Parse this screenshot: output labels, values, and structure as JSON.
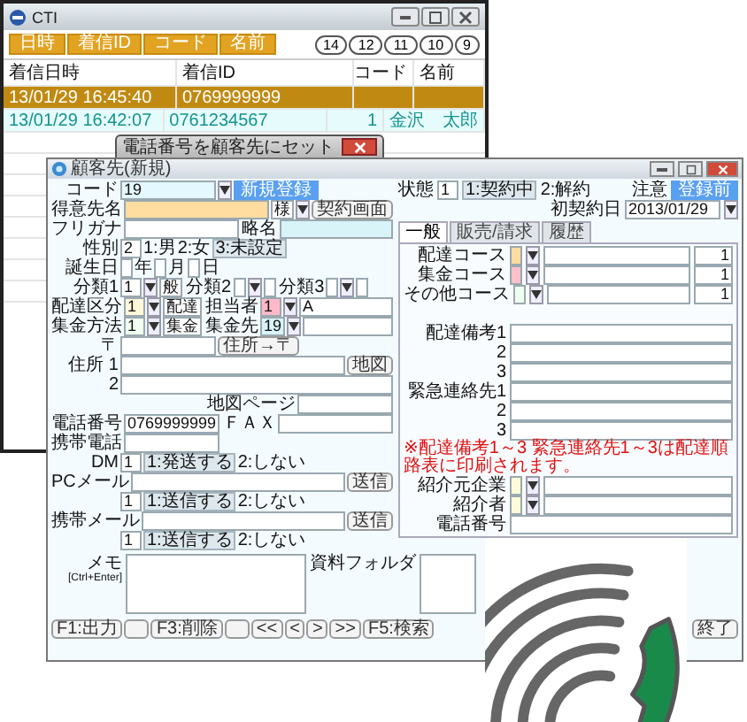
{
  "cti_window": {
    "title": "CTI",
    "tabs": [
      "日時",
      "着信ID",
      "コード",
      "名前"
    ],
    "page_tabs": [
      "14",
      "12",
      "11",
      "10",
      "9"
    ],
    "columns": [
      "着信日時",
      "着信ID",
      "コード",
      "名前"
    ],
    "rows": [
      {
        "cells": [
          "13/01/29 16:45:40",
          "0769999999",
          "",
          ""
        ],
        "selected": true
      },
      {
        "cells": [
          "13/01/29 16:42:07",
          "0761234567",
          "1",
          "金沢　太郎"
        ],
        "selected": false
      }
    ]
  },
  "dialog": {
    "title": "電話番号を顧客先にセット"
  },
  "customer_window": {
    "title": "顧客先(新規)",
    "left_rows": [
      {
        "items": [
          {
            "kind": "label",
            "text": "コード"
          },
          {
            "kind": "mid",
            "value": "19",
            "color": "#e4f8ff"
          },
          {
            "kind": "drop"
          },
          {
            "kind": "action",
            "text": "新規登録"
          }
        ]
      },
      {
        "items": [
          {
            "kind": "label",
            "text": "得意先名"
          },
          {
            "kind": "wide",
            "color": "#ffdca0"
          },
          {
            "kind": "field",
            "value": "様"
          },
          {
            "kind": "drop"
          },
          {
            "kind": "btn",
            "text": "契約画面"
          }
        ]
      },
      {
        "items": [
          {
            "kind": "label",
            "text": "フリガナ"
          },
          {
            "kind": "wide"
          },
          {
            "kind": "label",
            "text": "略名"
          },
          {
            "kind": "wide",
            "color": "#d8f4f8"
          }
        ]
      },
      {
        "items": [
          {
            "kind": "label",
            "text": "性別"
          },
          {
            "kind": "field",
            "value": "2"
          },
          {
            "kind": "text",
            "text": "1:男"
          },
          {
            "kind": "text",
            "text": "2:女"
          },
          {
            "kind": "opt",
            "text": "3:未設定"
          }
        ]
      },
      {
        "items": [
          {
            "kind": "label",
            "text": "誕生日"
          },
          {
            "kind": "field"
          },
          {
            "kind": "text",
            "text": "年"
          },
          {
            "kind": "field"
          },
          {
            "kind": "text",
            "text": "月"
          },
          {
            "kind": "field"
          },
          {
            "kind": "text",
            "text": "日"
          }
        ]
      },
      {
        "items": [
          {
            "kind": "label",
            "text": "分類1"
          },
          {
            "kind": "field",
            "value": "1"
          },
          {
            "kind": "drop"
          },
          {
            "kind": "field",
            "value": "般"
          },
          {
            "kind": "label",
            "text": "分類2"
          },
          {
            "kind": "field"
          },
          {
            "kind": "drop"
          },
          {
            "kind": "field"
          },
          {
            "kind": "label",
            "text": "分類3"
          },
          {
            "kind": "field"
          },
          {
            "kind": "drop"
          },
          {
            "kind": "field"
          }
        ]
      },
      {
        "items": [
          {
            "kind": "label",
            "text": "配達区分"
          },
          {
            "kind": "field",
            "value": "1",
            "color": "#fff8d8"
          },
          {
            "kind": "drop"
          },
          {
            "kind": "field",
            "value": "配達"
          },
          {
            "kind": "label",
            "text": "担当者"
          },
          {
            "kind": "field",
            "value": "1",
            "color": "#ffb8c8"
          },
          {
            "kind": "drop"
          },
          {
            "kind": "wide",
            "value": "A"
          }
        ]
      },
      {
        "items": [
          {
            "kind": "label",
            "text": "集金方法"
          },
          {
            "kind": "field",
            "value": "1",
            "color": "#f0fff0"
          },
          {
            "kind": "drop"
          },
          {
            "kind": "field",
            "value": "集金"
          },
          {
            "kind": "label",
            "text": "集金先"
          },
          {
            "kind": "field",
            "value": "19",
            "color": "#d8f4f8"
          },
          {
            "kind": "drop"
          },
          {
            "kind": "wide"
          }
        ]
      },
      {
        "items": [
          {
            "kind": "label",
            "text": "〒"
          },
          {
            "kind": "mid"
          },
          {
            "kind": "btn",
            "text": "住所→〒"
          }
        ]
      },
      {
        "items": [
          {
            "kind": "label",
            "text": "住所 1"
          },
          {
            "kind": "wide"
          },
          {
            "kind": "btn",
            "text": "地図"
          }
        ]
      },
      {
        "items": [
          {
            "kind": "label",
            "text": "2"
          },
          {
            "kind": "wide"
          }
        ]
      },
      {
        "items": [
          {
            "kind": "gap"
          },
          {
            "kind": "label",
            "text": "地図ページ"
          },
          {
            "kind": "mid"
          }
        ]
      },
      {
        "items": [
          {
            "kind": "label",
            "text": "電話番号"
          },
          {
            "kind": "mid",
            "value": "0769999999"
          },
          {
            "kind": "label",
            "text": "ＦＡＸ"
          },
          {
            "kind": "wide"
          }
        ]
      },
      {
        "items": [
          {
            "kind": "label",
            "text": "携帯電話"
          },
          {
            "kind": "mid"
          }
        ]
      },
      {
        "items": [
          {
            "kind": "label",
            "text": "DM"
          },
          {
            "kind": "field",
            "value": "1"
          },
          {
            "kind": "opt",
            "text": "1:発送する"
          },
          {
            "kind": "text",
            "text": "2:しない"
          }
        ]
      },
      {
        "items": [
          {
            "kind": "label",
            "text": "PCメール"
          },
          {
            "kind": "wide"
          },
          {
            "kind": "btn",
            "text": "送信"
          }
        ]
      },
      {
        "items": [
          {
            "kind": "indent"
          },
          {
            "kind": "field",
            "value": "1"
          },
          {
            "kind": "opt",
            "text": "1:送信する"
          },
          {
            "kind": "text",
            "text": "2:しない"
          }
        ]
      },
      {
        "items": [
          {
            "kind": "label",
            "text": "携帯メール"
          },
          {
            "kind": "wide"
          },
          {
            "kind": "btn",
            "text": "送信"
          }
        ]
      },
      {
        "items": [
          {
            "kind": "indent"
          },
          {
            "kind": "field",
            "value": "1"
          },
          {
            "kind": "opt",
            "text": "1:送信する"
          },
          {
            "kind": "text",
            "text": "2:しない"
          }
        ]
      }
    ],
    "right_rows": [
      {
        "items": [
          {
            "kind": "label",
            "text": "状態"
          },
          {
            "kind": "field",
            "value": "1"
          },
          {
            "kind": "opt",
            "text": "1:契約中"
          },
          {
            "kind": "text",
            "text": "2:解約"
          },
          {
            "kind": "gap"
          },
          {
            "kind": "label",
            "text": "注意"
          },
          {
            "kind": "action",
            "text": "登録前"
          }
        ]
      },
      {
        "items": [
          {
            "kind": "gap"
          },
          {
            "kind": "label",
            "text": "初契約日"
          },
          {
            "kind": "mid",
            "value": "2013/01/29"
          },
          {
            "kind": "drop"
          }
        ]
      }
    ],
    "tabs": [
      {
        "label": "一般",
        "selected": true
      },
      {
        "label": "販売/請求",
        "selected": false
      },
      {
        "label": "履歴",
        "selected": false
      }
    ],
    "tab_rows": [
      {
        "items": [
          {
            "kind": "label",
            "text": "配達コース"
          },
          {
            "kind": "field",
            "color": "#ffdca0"
          },
          {
            "kind": "drop"
          },
          {
            "kind": "wide"
          },
          {
            "kind": "num",
            "value": "1"
          }
        ]
      },
      {
        "items": [
          {
            "kind": "label",
            "text": "集金コース"
          },
          {
            "kind": "field",
            "color": "#ffc0c8"
          },
          {
            "kind": "drop"
          },
          {
            "kind": "wide"
          },
          {
            "kind": "num",
            "value": "1"
          }
        ]
      },
      {
        "items": [
          {
            "kind": "label",
            "text": "その他コース"
          },
          {
            "kind": "field",
            "color": "#f0fff0"
          },
          {
            "kind": "drop"
          },
          {
            "kind": "wide"
          },
          {
            "kind": "num",
            "value": "1"
          }
        ]
      },
      {
        "items": [
          {
            "kind": "space"
          }
        ]
      },
      {
        "items": [
          {
            "kind": "label",
            "text": "配達備考1"
          },
          {
            "kind": "wide"
          }
        ]
      },
      {
        "items": [
          {
            "kind": "label",
            "text": "2"
          },
          {
            "kind": "wide"
          }
        ]
      },
      {
        "items": [
          {
            "kind": "label",
            "text": "3"
          },
          {
            "kind": "wide"
          }
        ]
      },
      {
        "items": [
          {
            "kind": "label",
            "text": "緊急連絡先1"
          },
          {
            "kind": "wide"
          }
        ]
      },
      {
        "items": [
          {
            "kind": "label",
            "text": "2"
          },
          {
            "kind": "wide"
          }
        ]
      },
      {
        "items": [
          {
            "kind": "label",
            "text": "3"
          },
          {
            "kind": "wide"
          }
        ]
      },
      {
        "items": [
          {
            "kind": "note",
            "text": "※配達備考1～3 緊急連絡先1～3は配達順路表に印刷されます。"
          }
        ]
      },
      {
        "items": [
          {
            "kind": "label",
            "text": "紹介元企業"
          },
          {
            "kind": "field",
            "color": "#fffbd8"
          },
          {
            "kind": "drop"
          },
          {
            "kind": "wide"
          }
        ]
      },
      {
        "items": [
          {
            "kind": "label",
            "text": "紹介者"
          },
          {
            "kind": "field",
            "color": "#fffbd8"
          },
          {
            "kind": "drop"
          },
          {
            "kind": "wide"
          }
        ]
      },
      {
        "items": [
          {
            "kind": "label",
            "text": "電話番号"
          },
          {
            "kind": "wide"
          }
        ]
      }
    ],
    "memo": {
      "label": "メモ",
      "hint": "[Ctrl+Enter]"
    },
    "folder": {
      "label": "資料フォルダ"
    },
    "bottom_buttons": [
      {
        "kind": "btn",
        "text": "F1:出力"
      },
      {
        "kind": "blank"
      },
      {
        "kind": "btn",
        "text": "F3:削除"
      },
      {
        "kind": "blank"
      },
      {
        "kind": "btn",
        "text": "<<"
      },
      {
        "kind": "btn",
        "text": "<"
      },
      {
        "kind": "btn",
        "text": ">"
      },
      {
        "kind": "btn",
        "text": ">>"
      },
      {
        "kind": "btn",
        "text": "F5:検索"
      }
    ],
    "end_button": "終了"
  }
}
